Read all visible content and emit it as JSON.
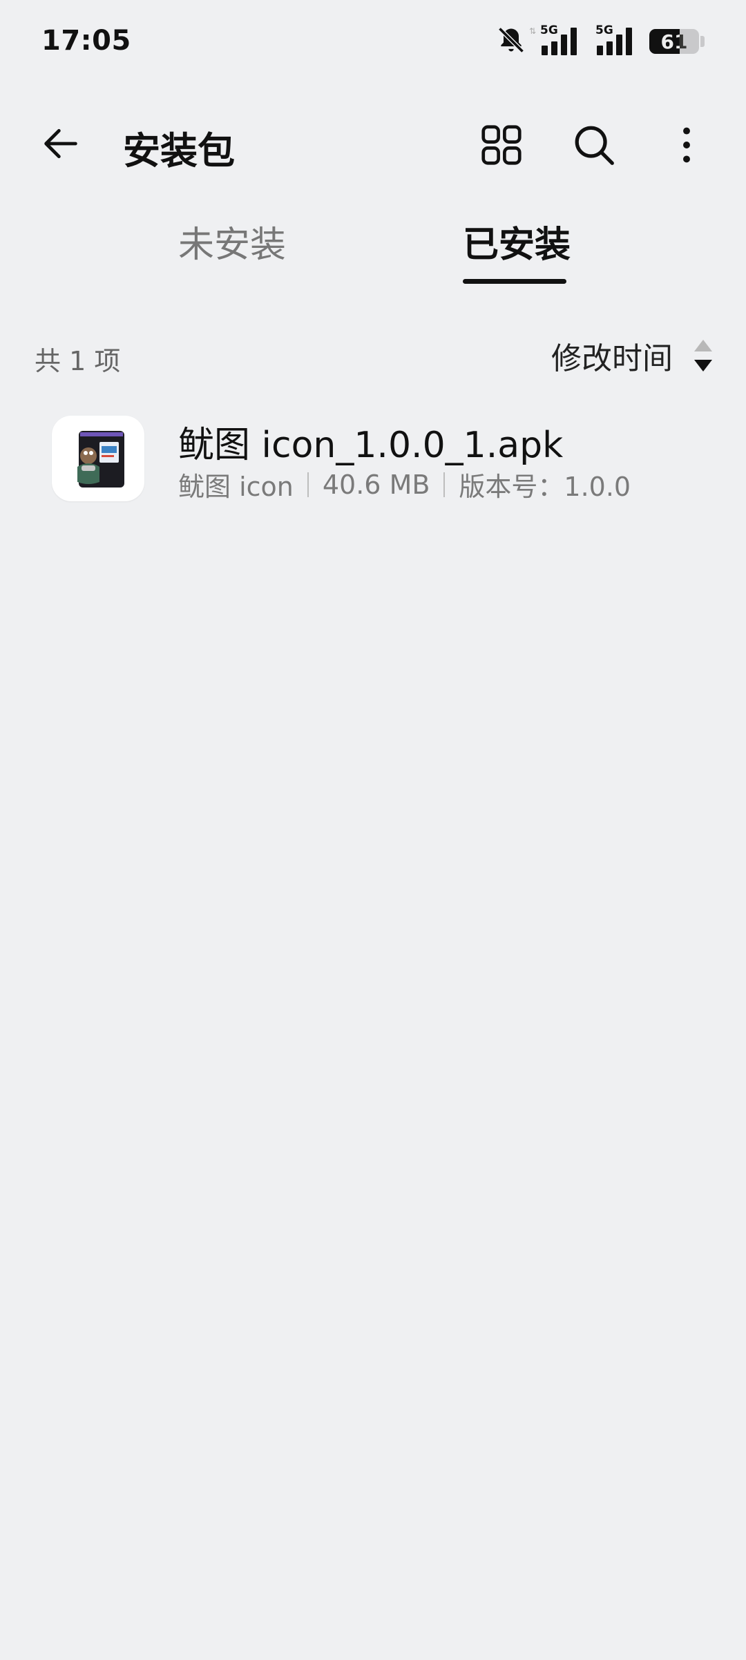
{
  "status_bar": {
    "time": "17:05",
    "network_type_1": "5G",
    "network_type_2": "5G",
    "battery_percent": "61",
    "battery_level": 0.61,
    "icons": [
      "bell-off-icon",
      "signal-icon",
      "signal-icon",
      "battery-icon"
    ]
  },
  "app_bar": {
    "title": "安装包",
    "back_icon": "arrow-left-icon",
    "actions": [
      "grid-view-icon",
      "search-icon",
      "more-vert-icon"
    ]
  },
  "tabs": [
    {
      "label": "未安装",
      "selected": false
    },
    {
      "label": "已安装",
      "selected": true
    }
  ],
  "list_header": {
    "count": "共 1 项",
    "sort_label": "修改时间",
    "sort_icon": "sort-arrows-icon"
  },
  "files": [
    {
      "name": "鱿图 icon_1.0.0_1.apk",
      "app_name": "鱿图 icon",
      "size": "40.6 MB",
      "version": "版本号：1.0.0",
      "icon": "app-icon"
    }
  ],
  "colors": {
    "background": "#eff0f2",
    "text_primary": "#111111",
    "text_secondary": "#7a7a7a",
    "indicator": "#111111"
  }
}
